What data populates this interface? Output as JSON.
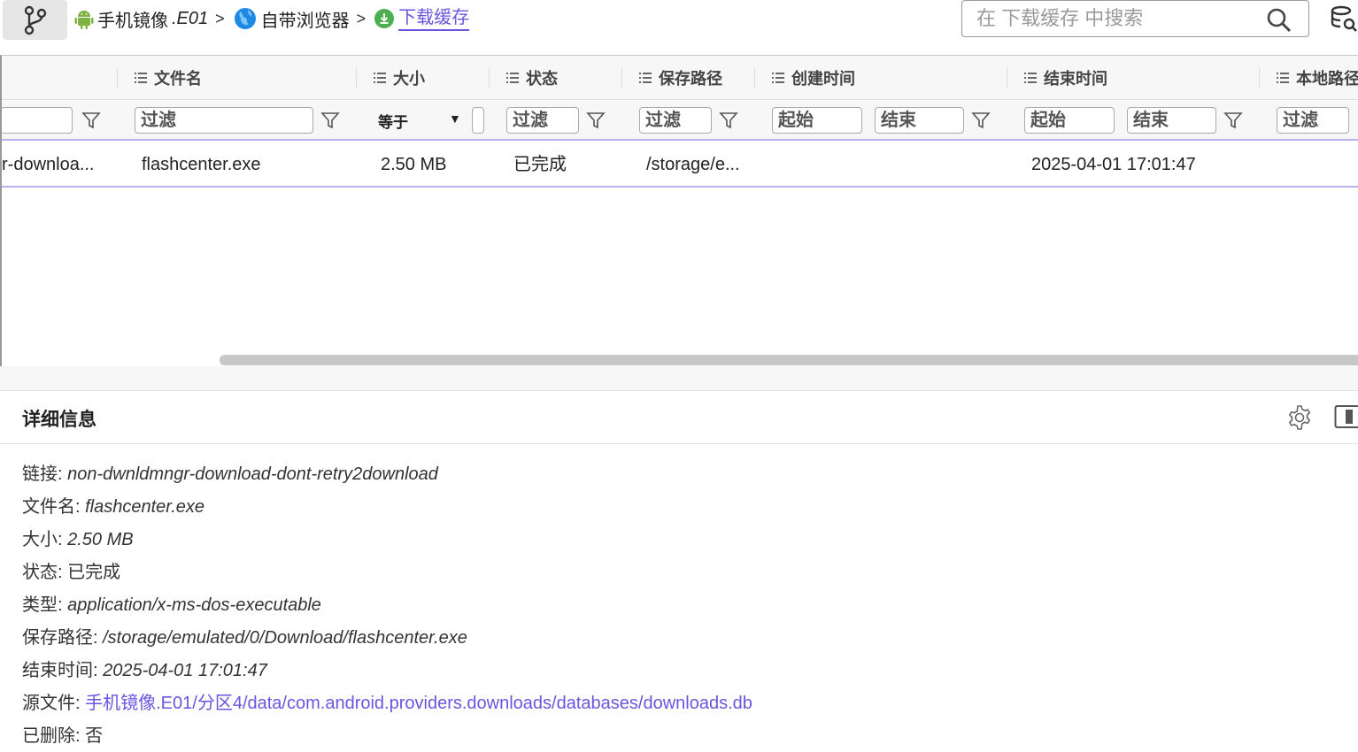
{
  "breadcrumb": {
    "items": [
      {
        "label": "手机镜像",
        "suffix": ".E01",
        "icon": "android-icon"
      },
      {
        "label": "自带浏览器",
        "icon": "globe-icon"
      },
      {
        "label": "下载缓存",
        "icon": "download-icon"
      }
    ],
    "separator": ">"
  },
  "search": {
    "placeholder": "在 下载缓存 中搜索"
  },
  "grid": {
    "columns": [
      {
        "label": "文件名"
      },
      {
        "label": "大小"
      },
      {
        "label": "状态"
      },
      {
        "label": "保存路径"
      },
      {
        "label": "创建时间"
      },
      {
        "label": "结束时间"
      },
      {
        "label": "本地路径"
      }
    ],
    "filters": {
      "filter_placeholder": "过滤",
      "equals_label": "等于",
      "start_label": "起始",
      "end_label": "结束"
    },
    "rows": [
      {
        "url": "r-downloa...",
        "filename": "flashcenter.exe",
        "size": "2.50 MB",
        "status": "已完成",
        "save_path": "/storage/e...",
        "created": "",
        "ended": "2025-04-01 17:01:47"
      }
    ]
  },
  "details": {
    "title": "详细信息",
    "fields": [
      {
        "key": "链接:",
        "value": "non-dwnldmngr-download-dont-retry2download"
      },
      {
        "key": "文件名:",
        "value": "flashcenter.exe"
      },
      {
        "key": "大小:",
        "value": "2.50 MB"
      },
      {
        "key": "状态:",
        "value": "已完成"
      },
      {
        "key": "类型:",
        "value": "application/x-ms-dos-executable"
      },
      {
        "key": "保存路径:",
        "value": "/storage/emulated/0/Download/flashcenter.exe"
      },
      {
        "key": "结束时间:",
        "value": "2025-04-01 17:01:47"
      },
      {
        "key": "源文件:",
        "value": "手机镜像.E01/分区4/data/com.android.providers.downloads/databases/downloads.db"
      },
      {
        "key": "已删除:",
        "value": "否"
      }
    ]
  },
  "colors": {
    "accent": "#6a55e0",
    "android": "#7cb342",
    "download": "#4caf50",
    "globe": "#1e88e5"
  }
}
